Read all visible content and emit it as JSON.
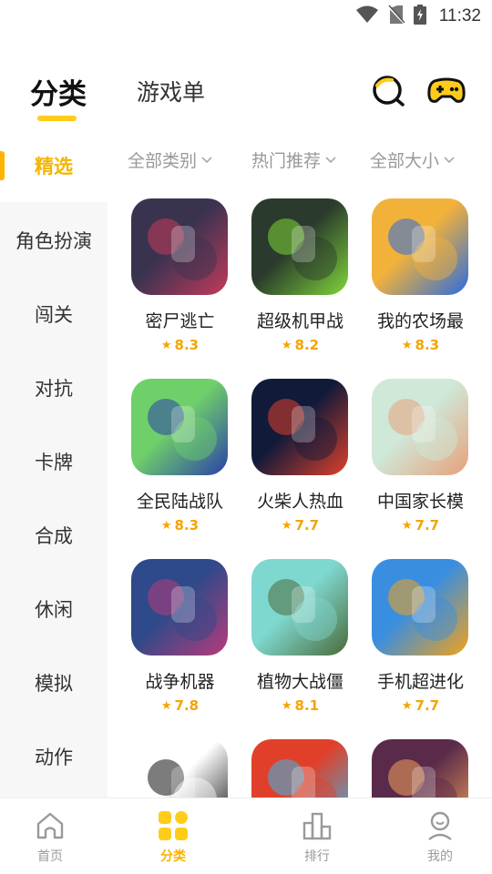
{
  "status_bar": {
    "time": "11:32"
  },
  "top_tabs": {
    "active": "分类",
    "inactive": "游戏单"
  },
  "sidebar": {
    "items": [
      {
        "label": "精选"
      },
      {
        "label": "角色扮演"
      },
      {
        "label": "闯关"
      },
      {
        "label": "对抗"
      },
      {
        "label": "卡牌"
      },
      {
        "label": "合成"
      },
      {
        "label": "休闲"
      },
      {
        "label": "模拟"
      },
      {
        "label": "动作"
      }
    ]
  },
  "filters": [
    {
      "label": "全部类别"
    },
    {
      "label": "热门推荐"
    },
    {
      "label": "全部大小"
    }
  ],
  "games": [
    {
      "name": "密尸逃亡",
      "rating": "8.3",
      "icon": "ghost-girls-thumbnail",
      "colors": [
        "#3a3350",
        "#c23a5a"
      ]
    },
    {
      "name": "超级机甲战",
      "rating": "8.2",
      "icon": "mecha-robot-thumbnail",
      "colors": [
        "#2a3a2c",
        "#7fd63a"
      ]
    },
    {
      "name": "我的农场最",
      "rating": "8.3",
      "icon": "farm-stickman-thumbnail",
      "colors": [
        "#f2b23a",
        "#2b6be0"
      ]
    },
    {
      "name": "全民陆战队",
      "rating": "8.3",
      "icon": "robot-gunner-thumbnail",
      "colors": [
        "#6fd06a",
        "#2b3fa8"
      ]
    },
    {
      "name": "火柴人热血",
      "rating": "7.7",
      "icon": "stickman-fight-thumbnail",
      "colors": [
        "#121a3a",
        "#e0402a"
      ]
    },
    {
      "name": "中国家长模",
      "rating": "7.7",
      "icon": "family-thumbnail",
      "colors": [
        "#cfe8d8",
        "#e7a07a"
      ]
    },
    {
      "name": "战争机器",
      "rating": "7.8",
      "icon": "war-robot-thumbnail",
      "colors": [
        "#2e4a8a",
        "#b83a7a"
      ]
    },
    {
      "name": "植物大战僵",
      "rating": "8.1",
      "icon": "zombie-crosshair-thumbnail",
      "colors": [
        "#7fd8cf",
        "#4a6a3a"
      ]
    },
    {
      "name": "手机超进化",
      "rating": "7.7",
      "icon": "phone-evolve-thumbnail",
      "colors": [
        "#3a8ee0",
        "#f2a21a"
      ]
    },
    {
      "name": "",
      "rating": "",
      "icon": "stickman-stilts-thumbnail",
      "colors": [
        "#ffffff",
        "#111111"
      ]
    },
    {
      "name": "",
      "rating": "",
      "icon": "fire-water-thumbnail",
      "colors": [
        "#e0402a",
        "#39b6e8"
      ]
    },
    {
      "name": "",
      "rating": "",
      "icon": "blocky-halloween-thumbnail",
      "colors": [
        "#5a2a4a",
        "#f0a05a"
      ]
    }
  ],
  "bottom_nav": [
    {
      "label": "首页",
      "icon": "home-icon"
    },
    {
      "label": "分类",
      "icon": "category-icon"
    },
    {
      "label": "排行",
      "icon": "ranking-icon"
    },
    {
      "label": "我的",
      "icon": "profile-icon"
    }
  ],
  "theme": {
    "accent": "#ffcc1a",
    "accent_text": "#f5b400",
    "rating_color": "#f5a400"
  }
}
